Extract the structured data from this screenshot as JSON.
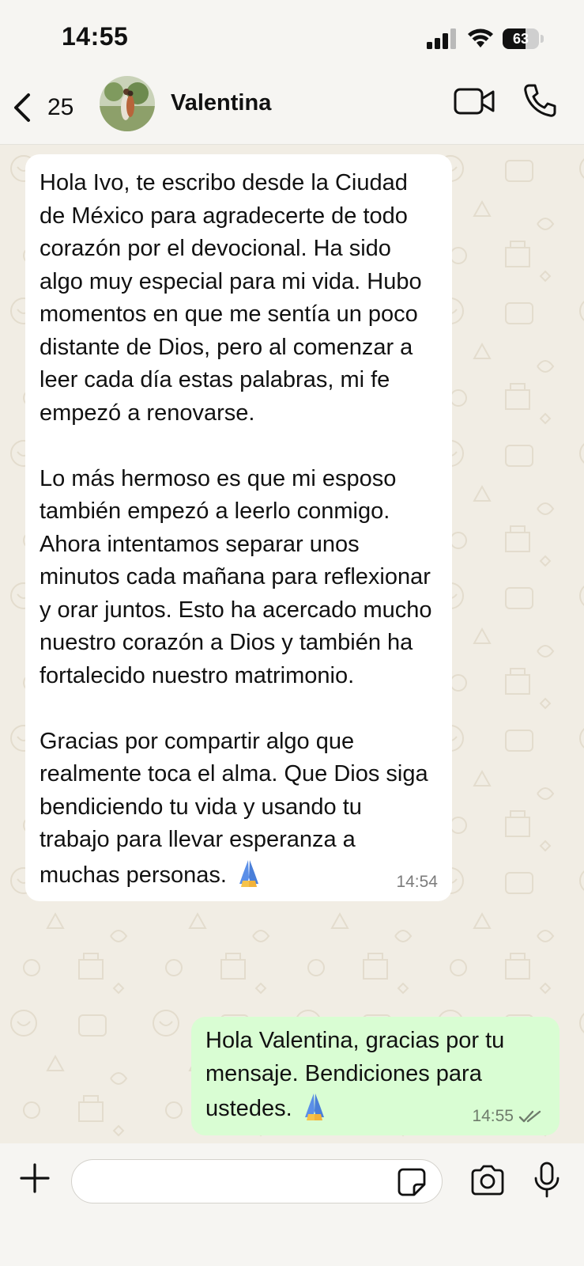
{
  "status_bar": {
    "time": "14:55",
    "battery_percent": "63",
    "battery_level": 0.63
  },
  "header": {
    "back_count": "25",
    "contact_name": "Valentina",
    "icons": [
      "back-chevron-icon",
      "avatar",
      "video-call-icon",
      "phone-icon"
    ]
  },
  "messages": [
    {
      "direction": "incoming",
      "text": "Hola Ivo, te escribo desde la Ciudad de México para agradecerte de todo corazón por el devocional. Ha sido algo muy especial para mi vida. Hubo momentos en que me sentía un poco distante de Dios, pero al comenzar a leer cada día estas palabras, mi fe empezó a renovarse.\n\nLo más hermoso es que mi esposo también empezó a leerlo conmigo. Ahora intentamos separar unos minutos cada mañana para reflexionar y orar juntos. Esto ha acercado mucho nuestro corazón a Dios y también ha fortalecido nuestro matrimonio.\n\nGracias por compartir algo que realmente toca el alma. Que Dios siga bendiciendo tu vida y usando tu trabajo para llevar esperanza a muchas personas.",
      "emoji": "folded-hands",
      "time": "14:54"
    },
    {
      "direction": "outgoing",
      "text": "Hola Valentina, gracias por tu mensaje. Bendiciones para ustedes.",
      "emoji": "folded-hands",
      "time": "14:55",
      "status": "read"
    }
  ],
  "input": {
    "placeholder": "",
    "value": ""
  },
  "colors": {
    "incoming_bubble": "#ffffff",
    "outgoing_bubble": "#d9fdd3",
    "chat_background": "#f1ede4",
    "read_check": "#6f7c6c"
  }
}
